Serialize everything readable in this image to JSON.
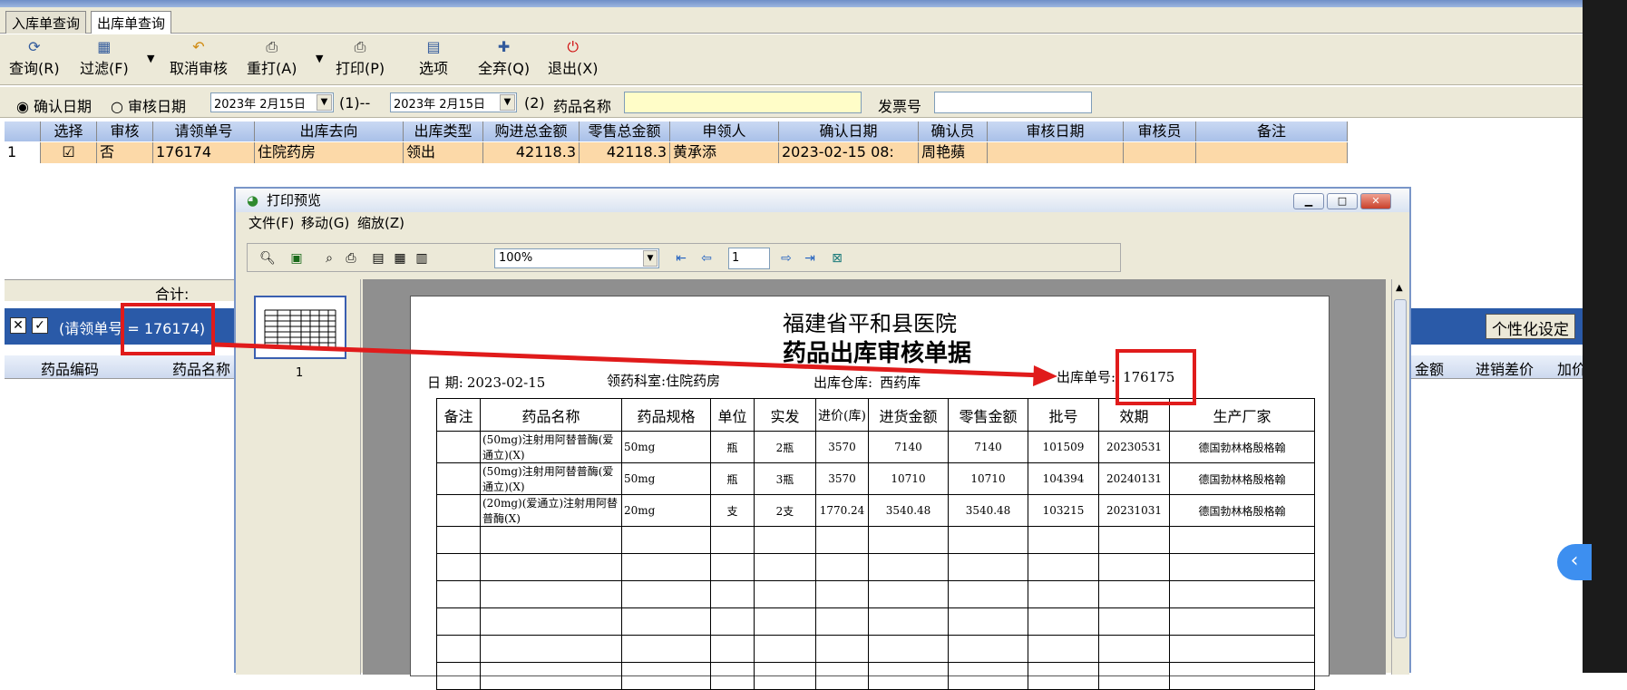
{
  "tabs": [
    "入库单查询",
    "出库单查询"
  ],
  "toolbar": {
    "query": "查询(R)",
    "filter": "过滤(F)",
    "cancel_review": "取消审核",
    "reprint": "重打(A)",
    "print": "打印(P)",
    "options": "选项",
    "abandon_all": "全弃(Q)",
    "exit": "退出(X)"
  },
  "filter": {
    "confirm_date": "确认日期",
    "review_date": "审核日期",
    "date_from": "2023年 2月15日",
    "label_1": "(1)--",
    "date_to": "2023年 2月15日",
    "label_2": "(2)",
    "drug_name_label": "药品名称",
    "drug_name_value": "",
    "invoice_label": "发票号",
    "invoice_value": ""
  },
  "main_table": {
    "columns": [
      "选择",
      "审核",
      "请领单号",
      "出库去向",
      "出库类型",
      "购进总金额",
      "零售总金额",
      "申领人",
      "确认日期",
      "确认员",
      "审核日期",
      "审核员",
      "备注"
    ],
    "rows": [
      {
        "no": "1",
        "select": "☑",
        "review": "否",
        "req_no": "176174",
        "dest": "住院药房",
        "type": "领出",
        "purchase_total": "42118.3",
        "retail_total": "42118.3",
        "applicant": "黄承添",
        "confirm_date": "2023-02-15 08:",
        "confirmer": "周艳蘋",
        "review_date": "",
        "reviewer": "",
        "note": ""
      }
    ],
    "sum_label": "合计:"
  },
  "detail_bar": {
    "filter_text": "(请领单号 = 176174)",
    "custom_button": "个性化设定"
  },
  "detail_columns": [
    "药品编码",
    "药品名称",
    "金额",
    "进销差价",
    "加价"
  ],
  "preview": {
    "title": "打印预览",
    "menu": [
      "文件(F)",
      "移动(G)",
      "缩放(Z)"
    ],
    "zoom": "100%",
    "page": "1",
    "thumb_label": "1",
    "doc": {
      "hospital": "福建省平和县医院",
      "doc_title": "药品出库审核单据",
      "date_label": "日   期:",
      "date_value": "2023-02-15",
      "dept_label": "领药科室:",
      "dept_value": "住院药房",
      "store_label": "出库仓库:",
      "store_value": "西药库",
      "out_no_label": "出库单号:",
      "out_no_value": "176175",
      "columns": [
        "备注",
        "药品名称",
        "药品规格",
        "单位",
        "实发",
        "进价(库)",
        "进货金额",
        "零售金额",
        "批号",
        "效期",
        "生产厂家"
      ],
      "rows": [
        {
          "note": "",
          "name": "(50mg)注射用阿替普酶(爱通立)(X)",
          "spec": "50mg",
          "unit": "瓶",
          "qty": "2瓶",
          "price": "3570",
          "purchase": "7140",
          "retail": "7140",
          "batch": "101509",
          "expiry": "20230531",
          "maker": "德国勃林格殷格翰"
        },
        {
          "note": "",
          "name": "(50mg)注射用阿替普酶(爱通立)(X)",
          "spec": "50mg",
          "unit": "瓶",
          "qty": "3瓶",
          "price": "3570",
          "purchase": "10710",
          "retail": "10710",
          "batch": "104394",
          "expiry": "20240131",
          "maker": "德国勃林格殷格翰"
        },
        {
          "note": "",
          "name": "(20mg)(爱通立)注射用阿替普酶(X)",
          "spec": "20mg",
          "unit": "支",
          "qty": "2支",
          "price": "1770.24",
          "purchase": "3540.48",
          "retail": "3540.48",
          "batch": "103215",
          "expiry": "20231031",
          "maker": "德国勃林格殷格翰"
        }
      ]
    }
  },
  "colors": {
    "accent_red": "#e01b1b",
    "row_highlight": "#fcd9a8",
    "header_blue": "#2a5aa8"
  }
}
